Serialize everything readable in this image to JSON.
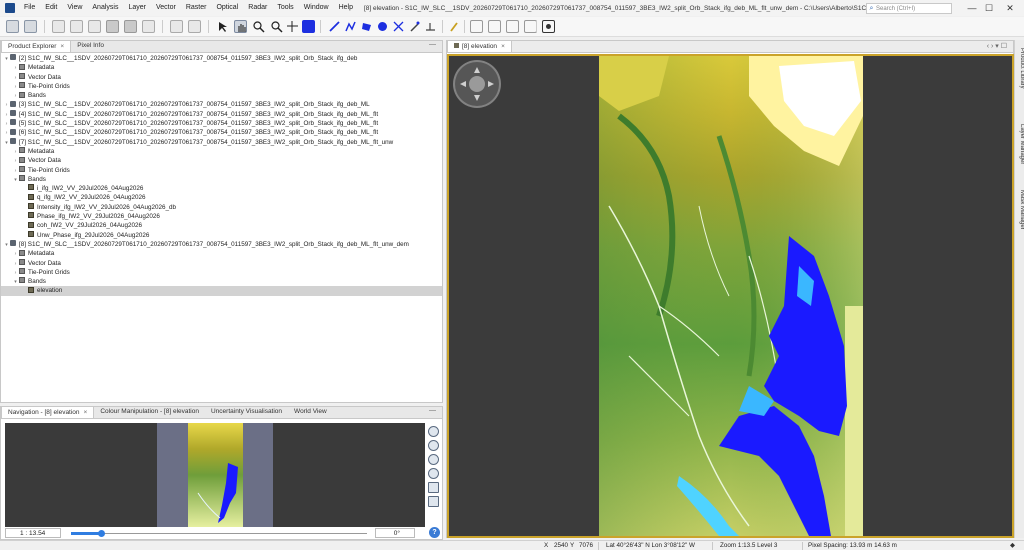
{
  "title_bar": {
    "menus": [
      "File",
      "Edit",
      "View",
      "Analysis",
      "Layer",
      "Vector",
      "Raster",
      "Optical",
      "Radar",
      "Tools",
      "Window",
      "Help"
    ],
    "window_title": "[8] elevation - S1C_IW_SLC__1SDV_20260729T061710_20260729T061737_008754_011597_3BE3_IW2_split_Orb_Stack_ifg_deb_ML_flt_unw_dem - C:\\Users\\Alberto\\S1C_IW_SLC__1SDV_2026072...",
    "search_placeholder": "Search (Ctrl+I)",
    "minimize": "—",
    "maximize": "☐",
    "close": "✕"
  },
  "product_explorer": {
    "tabs": [
      {
        "label": "Product Explorer",
        "close": "×"
      },
      {
        "label": "Pixel Info"
      }
    ],
    "minimize": "—",
    "rows": [
      {
        "label": "[2] S1C_IW_SLC__1SDV_20260729T061710_20260729T061737_008754_011597_3BE3_IW2_split_Orb_Stack_ifg_deb",
        "expander": "▾",
        "icon": "product",
        "level": 0
      },
      {
        "label": "Metadata",
        "expander": "›",
        "icon": "folder",
        "level": 1
      },
      {
        "label": "Vector Data",
        "expander": "›",
        "icon": "folder",
        "level": 1
      },
      {
        "label": "Tie-Point Grids",
        "expander": "›",
        "icon": "folder",
        "level": 1
      },
      {
        "label": "Bands",
        "expander": "›",
        "icon": "folder",
        "level": 1
      },
      {
        "label": "[3] S1C_IW_SLC__1SDV_20260729T061710_20260729T061737_008754_011597_3BE3_IW2_split_Orb_Stack_ifg_deb_ML",
        "expander": "›",
        "icon": "product",
        "level": 0
      },
      {
        "label": "[4] S1C_IW_SLC__1SDV_20260729T061710_20260729T061737_008754_011597_3BE3_IW2_split_Orb_Stack_ifg_deb_ML_flt",
        "expander": "›",
        "icon": "product",
        "level": 0
      },
      {
        "label": "[5] S1C_IW_SLC__1SDV_20260729T061710_20260729T061737_008754_011597_3BE3_IW2_split_Orb_Stack_ifg_deb_ML_flt",
        "expander": "›",
        "icon": "product",
        "level": 0
      },
      {
        "label": "[6] S1C_IW_SLC__1SDV_20260729T061710_20260729T061737_008754_011597_3BE3_IW2_split_Orb_Stack_ifg_deb_ML_flt",
        "expander": "›",
        "icon": "product",
        "level": 0
      },
      {
        "label": "[7] S1C_IW_SLC__1SDV_20260729T061710_20260729T061737_008754_011597_3BE3_IW2_split_Orb_Stack_ifg_deb_ML_flt_unw",
        "expander": "▾",
        "icon": "product",
        "level": 0
      },
      {
        "label": "Metadata",
        "expander": "›",
        "icon": "folder",
        "level": 1
      },
      {
        "label": "Vector Data",
        "expander": "›",
        "icon": "folder",
        "level": 1
      },
      {
        "label": "Tie-Point Grids",
        "expander": "›",
        "icon": "folder",
        "level": 1
      },
      {
        "label": "Bands",
        "expander": "▾",
        "icon": "folder",
        "level": 1
      },
      {
        "label": "i_ifg_IW2_VV_29Jul2026_04Aug2026",
        "expander": "",
        "icon": "band",
        "level": 2
      },
      {
        "label": "q_ifg_IW2_VV_29Jul2026_04Aug2026",
        "expander": "",
        "icon": "band",
        "level": 2
      },
      {
        "label": "Intensity_ifg_IW2_VV_29Jul2026_04Aug2026_db",
        "expander": "",
        "icon": "band",
        "level": 2
      },
      {
        "label": "Phase_ifg_IW2_VV_29Jul2026_04Aug2026",
        "expander": "",
        "icon": "band",
        "level": 2
      },
      {
        "label": "coh_IW2_VV_29Jul2026_04Aug2026",
        "expander": "",
        "icon": "band",
        "level": 2
      },
      {
        "label": "Unw_Phase_ifg_29Jul2026_04Aug2026",
        "expander": "",
        "icon": "band",
        "level": 2
      },
      {
        "label": "[8] S1C_IW_SLC__1SDV_20260729T061710_20260729T061737_008754_011597_3BE3_IW2_split_Orb_Stack_ifg_deb_ML_flt_unw_dem",
        "expander": "▾",
        "icon": "product",
        "level": 0
      },
      {
        "label": "Metadata",
        "expander": "›",
        "icon": "folder",
        "level": 1
      },
      {
        "label": "Vector Data",
        "expander": "›",
        "icon": "folder",
        "level": 1
      },
      {
        "label": "Tie-Point Grids",
        "expander": "›",
        "icon": "folder",
        "level": 1
      },
      {
        "label": "Bands",
        "expander": "▾",
        "icon": "folder",
        "level": 1
      },
      {
        "label": "elevation",
        "expander": "",
        "icon": "band",
        "level": 2,
        "selected": true
      }
    ]
  },
  "navigation": {
    "tabs": [
      {
        "label": "Navigation - [8] elevation",
        "close": "×"
      },
      {
        "label": "Colour Manipulation - [8] elevation"
      },
      {
        "label": "Uncertainty Visualisation"
      },
      {
        "label": "World View"
      }
    ],
    "minimize": "—",
    "scale": "1 : 13.54",
    "rotation": "0°",
    "help": "?",
    "zoom_fraction": 0.1
  },
  "image_view": {
    "tab_label": "[8] elevation",
    "tab_close": "×",
    "controls": "‹ › ▾ ☐"
  },
  "side_tabs": [
    "Product Library",
    "Layer Manager",
    "Mask Manager"
  ],
  "status_bar": {
    "x_label": "X",
    "x_value": "2540",
    "y_label": "Y",
    "y_value": "7076",
    "latlon": "Lat 40°26'43\" N  Lon 3°08'12\" W",
    "zoom": "Zoom 1:13.5  Level 3",
    "spacing": "Pixel Spacing: 13.93 m  14.63 m"
  },
  "colors": {
    "selection_frame": "#caa32a",
    "water": "#1a1aff",
    "lowland": "#3f8f3f",
    "highland": "#ffffff"
  }
}
